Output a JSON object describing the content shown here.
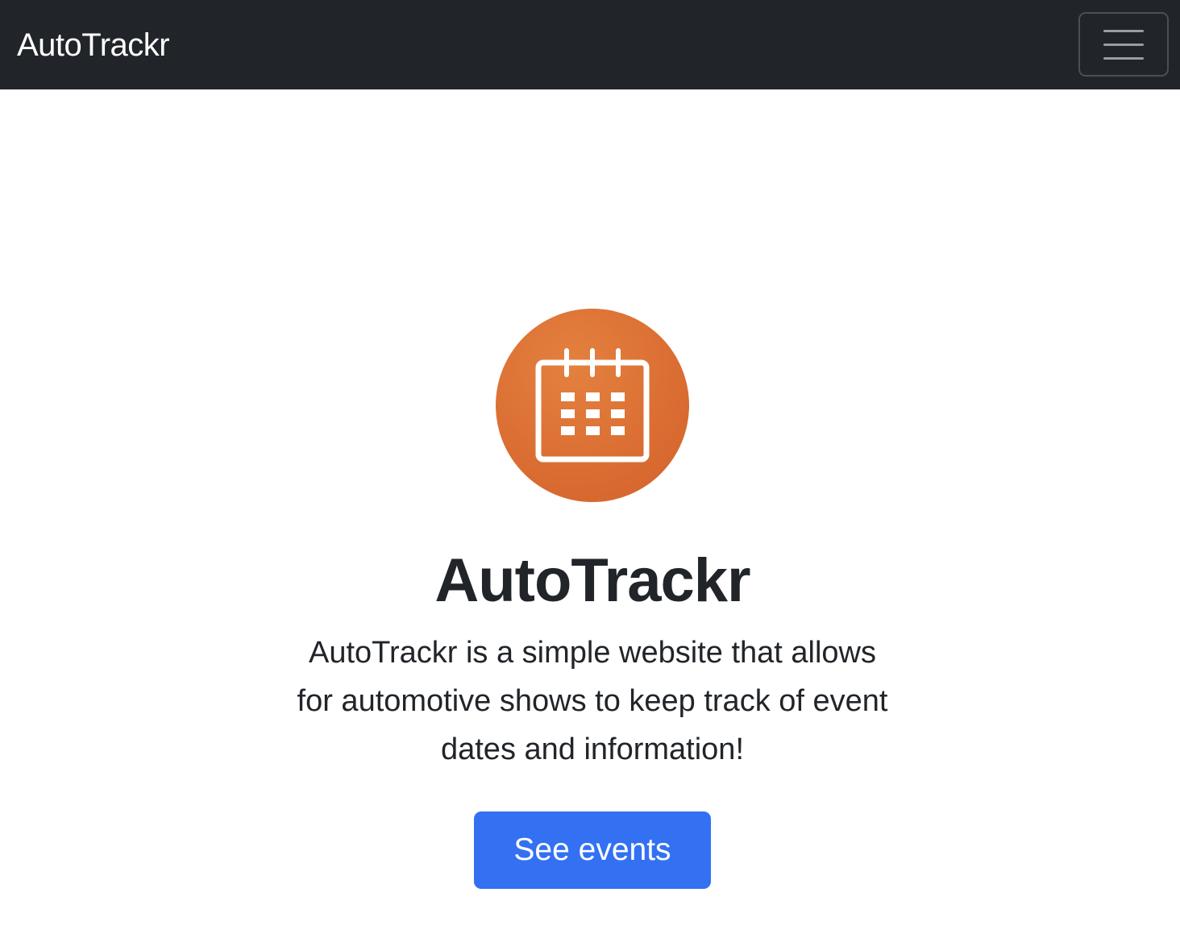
{
  "navbar": {
    "brand": "AutoTrackr",
    "toggle_icon": "hamburger-menu-icon"
  },
  "hero": {
    "icon": "calendar-icon",
    "icon_color": "#db6f33",
    "title": "AutoTrackr",
    "description": "AutoTrackr is a simple website that allows for automotive shows to keep track of event dates and information!",
    "cta_label": "See events",
    "cta_color": "#3371f2"
  },
  "colors": {
    "navbar_bg": "#212529",
    "text": "#212529"
  }
}
